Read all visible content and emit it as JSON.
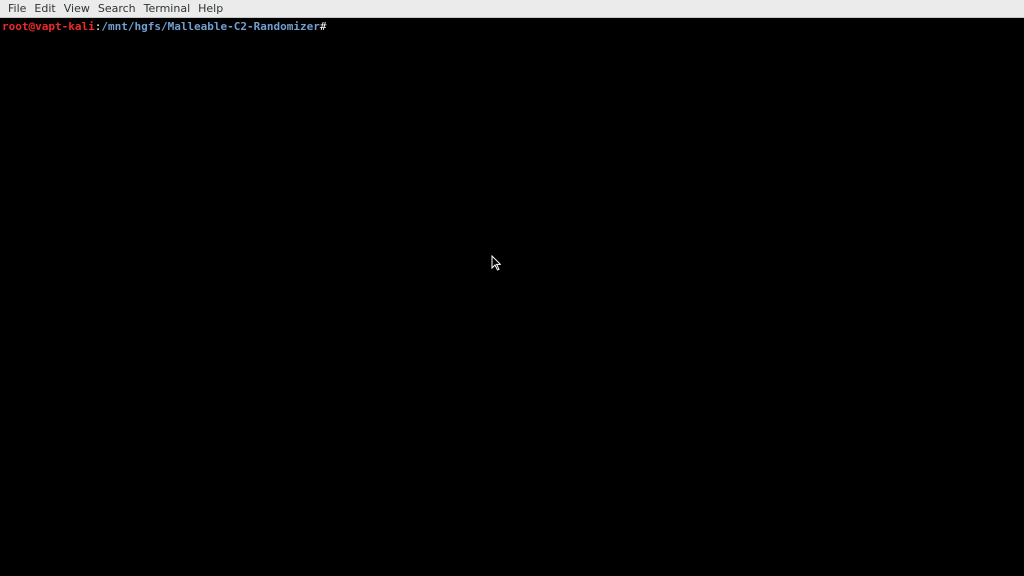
{
  "menubar": {
    "items": [
      {
        "label": "File"
      },
      {
        "label": "Edit"
      },
      {
        "label": "View"
      },
      {
        "label": "Search"
      },
      {
        "label": "Terminal"
      },
      {
        "label": "Help"
      }
    ]
  },
  "terminal": {
    "prompt": {
      "user_host": "root@vapt-kali",
      "separator": ":",
      "path": "/mnt/hgfs/Malleable-C2-Randomizer",
      "symbol": "#"
    }
  },
  "colors": {
    "user_host": "#ef2929",
    "path": "#729fcf",
    "background": "#000000",
    "menubar": "#ebebeb"
  },
  "icons": {
    "mouse_pointer": "arrow-pointer-icon"
  }
}
